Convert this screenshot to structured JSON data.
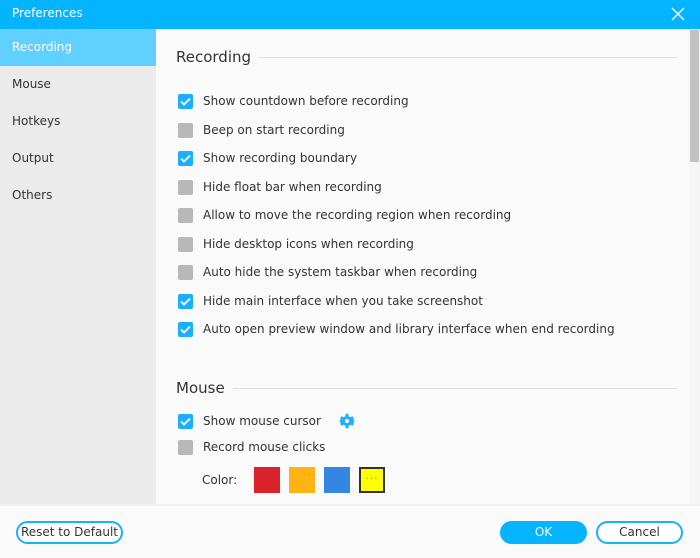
{
  "window": {
    "title": "Preferences",
    "close_icon": "close-icon"
  },
  "sidebar": {
    "items": [
      {
        "label": "Recording",
        "active": true
      },
      {
        "label": "Mouse",
        "active": false
      },
      {
        "label": "Hotkeys",
        "active": false
      },
      {
        "label": "Output",
        "active": false
      },
      {
        "label": "Others",
        "active": false
      }
    ]
  },
  "recording": {
    "heading": "Recording",
    "options": [
      {
        "label": "Show countdown before recording",
        "checked": true
      },
      {
        "label": "Beep on start recording",
        "checked": false
      },
      {
        "label": "Show recording boundary",
        "checked": true
      },
      {
        "label": "Hide float bar when recording",
        "checked": false
      },
      {
        "label": "Allow to move the recording region when recording",
        "checked": false
      },
      {
        "label": "Hide desktop icons when recording",
        "checked": false
      },
      {
        "label": "Auto hide the system taskbar when recording",
        "checked": false
      },
      {
        "label": "Hide main interface when you take screenshot",
        "checked": true
      },
      {
        "label": "Auto open preview window and library interface when end recording",
        "checked": true
      }
    ]
  },
  "mouse": {
    "heading": "Mouse",
    "options": [
      {
        "label": "Show mouse cursor",
        "checked": true,
        "settings_icon": "gear-icon"
      },
      {
        "label": "Record mouse clicks",
        "checked": false
      }
    ],
    "color_label": "Color:",
    "colors": [
      {
        "name": "red",
        "hex": "#d9222a"
      },
      {
        "name": "orange",
        "hex": "#ffb413"
      },
      {
        "name": "blue",
        "hex": "#3586e3"
      },
      {
        "name": "custom",
        "hex": "#ffff00",
        "label": "···",
        "selected": true
      }
    ]
  },
  "footer": {
    "reset_label": "Reset to Default",
    "ok_label": "OK",
    "cancel_label": "Cancel"
  },
  "colors": {
    "accent": "#04b4ff",
    "sidebar_active": "#5fd0ff",
    "checkbox_on": "#1aafff",
    "checkbox_off": "#b8b8b8"
  }
}
